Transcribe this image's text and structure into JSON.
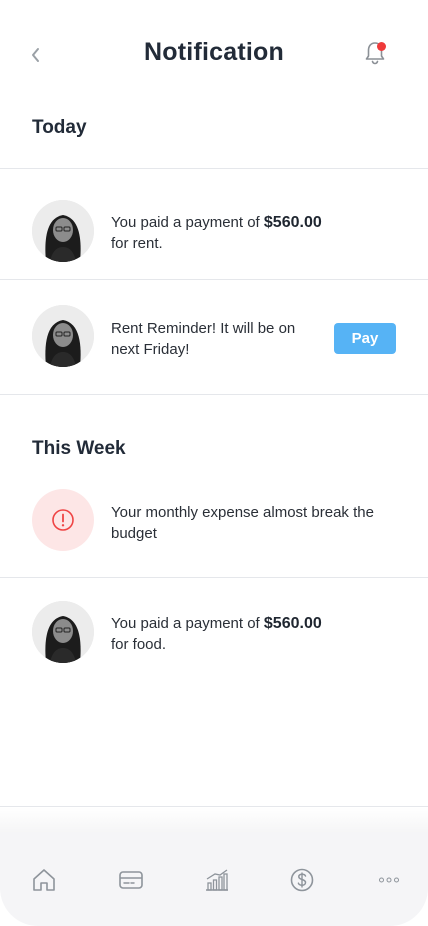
{
  "header": {
    "title": "Notification",
    "back_icon": "chevron-left-icon",
    "bell_icon": "bell-icon",
    "bell_badge_color": "#ef3a3a"
  },
  "sections": {
    "today": "Today",
    "this_week": "This Week"
  },
  "notifications": [
    {
      "text_before": "You paid a payment of ",
      "amount": "$560.00",
      "text_after": "for rent.",
      "icon": "avatar"
    },
    {
      "line1": "Rent Reminder! It will be on",
      "line2": "next Friday!",
      "action_label": "Pay",
      "icon": "avatar"
    },
    {
      "line1": "Your monthly expense almost break the",
      "line2": "budget",
      "icon": "alert-icon"
    },
    {
      "text_before": "You paid a payment of ",
      "amount": "$560.00",
      "text_after": "for food.",
      "icon": "avatar"
    }
  ],
  "tabbar": {
    "items": [
      "home-icon",
      "card-icon",
      "chart-icon",
      "dollar-icon",
      "more-icon"
    ]
  },
  "colors": {
    "accent": "#56b3f5",
    "alert": "#ef4444",
    "alert_bg": "#fde6e6"
  }
}
